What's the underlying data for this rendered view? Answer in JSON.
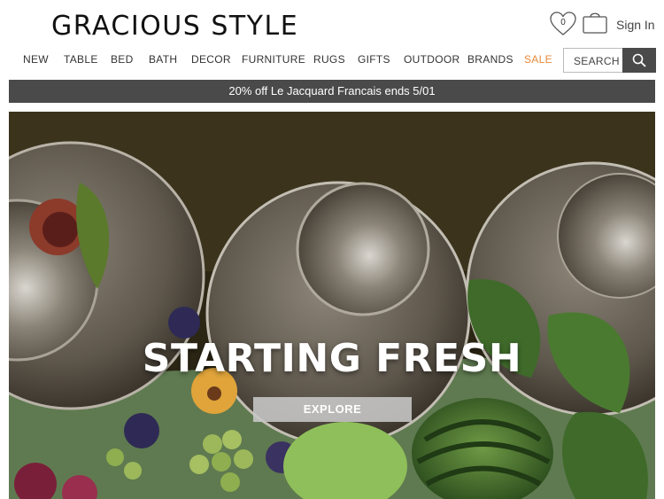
{
  "header": {
    "logo": "GRACIOUS STYLE",
    "wishlist_count": "0",
    "sign_in_label": "Sign In",
    "icons": {
      "wishlist": "heart-icon",
      "cart": "shopping-bag-icon",
      "search": "search-icon"
    }
  },
  "nav": {
    "items": [
      {
        "label": "NEW"
      },
      {
        "label": "TABLE"
      },
      {
        "label": "BED"
      },
      {
        "label": "BATH"
      },
      {
        "label": "DECOR"
      },
      {
        "label": "FURNITURE"
      },
      {
        "label": "RUGS"
      },
      {
        "label": "GIFTS"
      },
      {
        "label": "OUTDOOR"
      },
      {
        "label": "BRANDS"
      },
      {
        "label": "SALE"
      }
    ],
    "sale_color": "#e8893a"
  },
  "search": {
    "label": "SEARCH"
  },
  "promo": {
    "text": "20% off Le Jacquard Francais ends 5/01"
  },
  "hero": {
    "title": "STARTING FRESH",
    "button_label": "EXPLORE"
  },
  "colors": {
    "dark_bar": "#4a4a4a",
    "sale_accent": "#e8893a"
  }
}
